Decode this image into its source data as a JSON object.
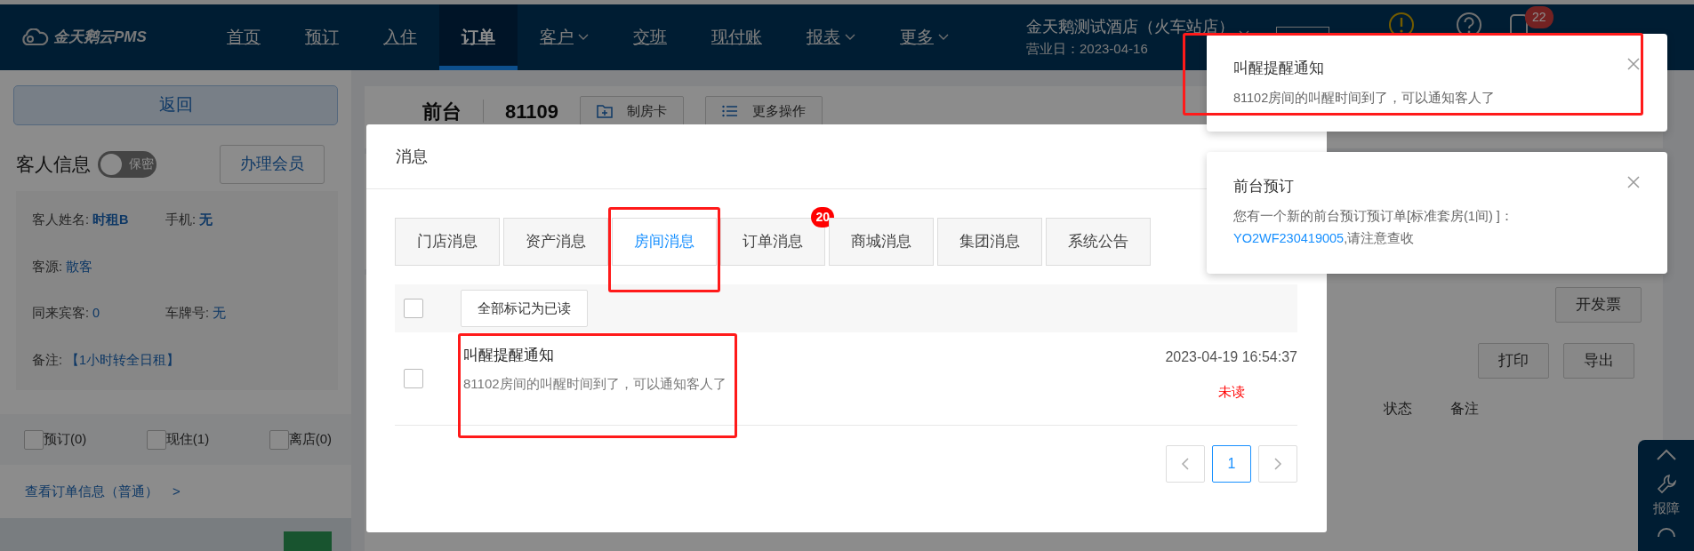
{
  "nav": {
    "logo": "金天鹅云PMS",
    "items": [
      {
        "label": "首页",
        "selected": false,
        "dropdown": false
      },
      {
        "label": "预订",
        "selected": false,
        "dropdown": false
      },
      {
        "label": "入住",
        "selected": false,
        "dropdown": false
      },
      {
        "label": "订单",
        "selected": true,
        "dropdown": false
      },
      {
        "label": "客户",
        "selected": false,
        "dropdown": true
      },
      {
        "label": "交班",
        "selected": false,
        "dropdown": false
      },
      {
        "label": "现付账",
        "selected": false,
        "dropdown": false
      },
      {
        "label": "报表",
        "selected": false,
        "dropdown": true
      },
      {
        "label": "更多",
        "selected": false,
        "dropdown": true
      }
    ],
    "hotel": {
      "name": "金天鹅测试酒店（火车站店）",
      "business_day": "营业日：2023-04-16"
    },
    "notification_badge": "22"
  },
  "sidebar": {
    "back_button": "返回",
    "guest_title": "客人信息",
    "privacy_toggle": {
      "label": "保密",
      "on": false
    },
    "member_button": "办理会员",
    "info_rows": [
      [
        {
          "label": "客人姓名:",
          "value": "时租B",
          "bold": true
        },
        {
          "label": "手机:",
          "value": "无",
          "bold": true
        }
      ],
      [
        {
          "label": "客源:",
          "value": "散客",
          "bold": false
        }
      ],
      [
        {
          "label": "同来宾客:",
          "value": "0",
          "bold": false
        },
        {
          "label": "车牌号:",
          "value": "无",
          "bold": false
        }
      ],
      [
        {
          "label": "备注:",
          "value": "【1小时转全日租】",
          "bold": false
        }
      ]
    ],
    "filters": [
      {
        "label": "预订(0)",
        "checked": false
      },
      {
        "label": "现住(1)",
        "checked": false
      },
      {
        "label": "离店(0)",
        "checked": false
      }
    ],
    "order_link": "查看订单信息（普通）",
    "order_link_arrow": ">"
  },
  "order": {
    "title": "前台",
    "number": "81109",
    "actions": [
      "制房卡",
      "更多操作"
    ],
    "invoice_button": "开发票",
    "print_button": "打印",
    "export_button": "导出",
    "columns": [
      "状态",
      "备注"
    ]
  },
  "side_tools": {
    "report_label": "报障"
  },
  "modal": {
    "title": "消息",
    "tabs": [
      {
        "label": "门店消息",
        "selected": false,
        "highlighted": false
      },
      {
        "label": "资产消息",
        "selected": false,
        "highlighted": false
      },
      {
        "label": "房间消息",
        "selected": true,
        "highlighted": true
      },
      {
        "label": "订单消息",
        "selected": false,
        "highlighted": false,
        "badge": "20"
      },
      {
        "label": "商城消息",
        "selected": false,
        "highlighted": false
      },
      {
        "label": "集团消息",
        "selected": false,
        "highlighted": false
      },
      {
        "label": "系统公告",
        "selected": false,
        "highlighted": false
      }
    ],
    "select_all_checked": false,
    "mark_all_button": "全部标记为已读",
    "messages": [
      {
        "title": "叫醒提醒通知",
        "body": "81102房间的叫醒时间到了，可以通知客人了",
        "time": "2023-04-19 16:54:37",
        "status": "未读",
        "checked": false,
        "highlighted": true
      }
    ],
    "pages": [
      {
        "label": "1",
        "selected": true
      }
    ]
  },
  "toasts": [
    {
      "title": "叫醒提醒通知",
      "body": "81102房间的叫醒时间到了，可以通知客人了",
      "highlighted": true
    },
    {
      "title": "前台预订",
      "body": "您有一个新的前台预订预订单[标准套房(1间) ]：",
      "link": "YO2WF230419005",
      "after_link": ",请注意查收",
      "highlighted": false
    }
  ]
}
